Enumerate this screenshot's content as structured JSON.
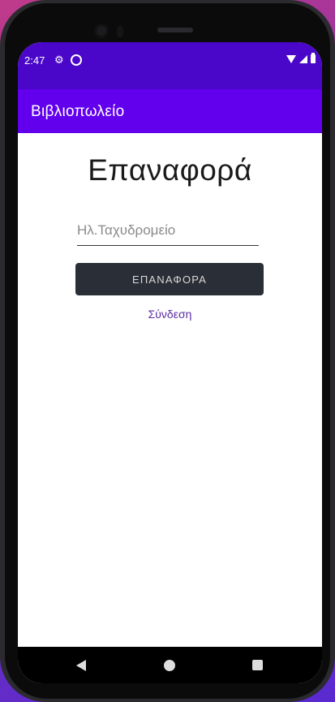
{
  "status_bar": {
    "time": "2:47",
    "icons": [
      "gear-icon",
      "sync-icon",
      "wifi-icon",
      "signal-icon",
      "battery-icon"
    ]
  },
  "app_bar": {
    "title": "Βιβλιοπωλείο"
  },
  "reset_screen": {
    "heading": "Επαναφορά",
    "email_placeholder": "Ηλ.Ταχυδρομείο",
    "email_value": "",
    "reset_button_label": "ΕΠΑΝΑΦΟΡΑ",
    "login_link_label": "Σύνδεση"
  },
  "colors": {
    "status_bar": "#4a07c9",
    "app_bar": "#6200ee",
    "button_bg": "#2a2e36",
    "link": "#5b2aa5"
  },
  "nav_bar": {
    "icons": [
      "back-icon",
      "home-icon",
      "recents-icon"
    ]
  }
}
